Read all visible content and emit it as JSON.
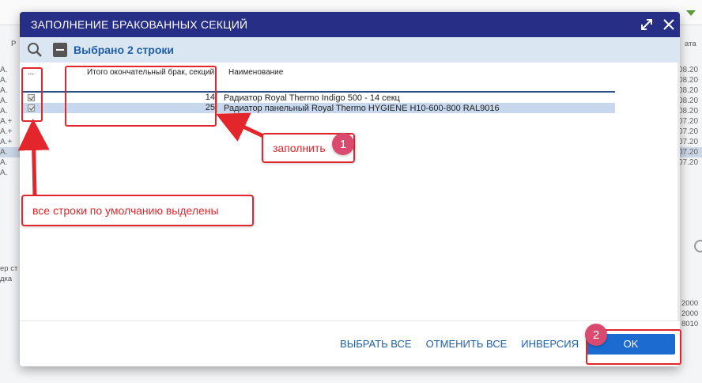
{
  "background": {
    "left_rows": [
      "A.",
      "A.",
      "A.",
      "A.",
      "A.",
      "A.+",
      "A.+",
      "A.+",
      "A.",
      "A.",
      "A."
    ],
    "right_rows": [
      "08.20",
      "08.20",
      "08.20",
      "08.20",
      "08.20",
      "07.20",
      "07.20",
      "07.20",
      "07.20",
      "07.20"
    ],
    "left_label_top": "Р",
    "left_label_1": "ер ст",
    "left_label_2": "дка",
    "right_label_top": "ата",
    "right_bottom_rows": [
      "2000",
      "2000",
      "8010"
    ]
  },
  "dialog": {
    "title": "ЗАПОЛНЕНИЕ БРАКОВАННЫХ СЕКЦИЙ",
    "selected_label": "Выбрано 2 строки",
    "columns": {
      "check": "...",
      "qty": "Итого окончательный брак, секций",
      "name": "Наименование"
    },
    "rows": [
      {
        "qty": "14",
        "name": "Радиатор Royal Thermo Indigo 500  - 14 секц",
        "checked": true
      },
      {
        "qty": "25",
        "name": "Радиатор панельный Royal Thermo HYGIENE H10-600-800 RAL9016",
        "checked": true
      }
    ],
    "footer": {
      "select_all": "ВЫБРАТЬ ВСЕ",
      "deselect_all": "ОТМЕНИТЬ ВСЕ",
      "invert": "ИНВЕРСИЯ",
      "ok": "OK"
    }
  },
  "annotations": {
    "fill_callout": "заполнить",
    "default_selected_callout": "все строки по умолчанию выделены",
    "badge_1": "1",
    "badge_2": "2"
  },
  "colors": {
    "title_bar": "#272e85",
    "toolbar": "#dbe6f3",
    "accent_text": "#1f5ea8",
    "ok_button": "#1b6bd1",
    "annotation_red": "#e3262b",
    "badge": "#d94a6e"
  }
}
